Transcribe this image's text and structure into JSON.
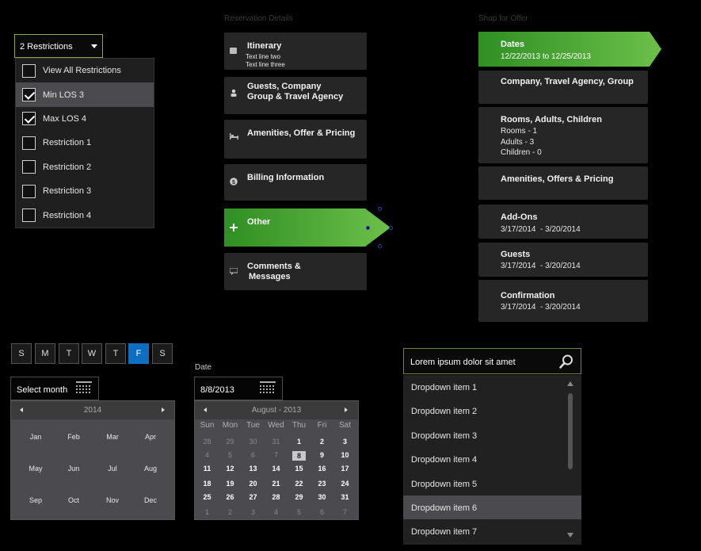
{
  "restrictions": {
    "button_label": "2 Restrictions",
    "items": [
      {
        "label": "View All Restrictions",
        "checked": false
      },
      {
        "label": "Min LOS 3",
        "checked": true
      },
      {
        "label": "Max LOS 4",
        "checked": true
      },
      {
        "label": "Restriction 1",
        "checked": false
      },
      {
        "label": "Restriction 2",
        "checked": false
      },
      {
        "label": "Restriction 3",
        "checked": false
      },
      {
        "label": "Restriction 4",
        "checked": false
      }
    ]
  },
  "reservation": {
    "title": "Reservation Details",
    "steps": [
      {
        "label": "Itinerary",
        "sub1": "Text line two",
        "sub2": "Text line three",
        "icon": "itinerary-icon"
      },
      {
        "label": "Guests, Company",
        "label2": "Group & Travel Agency",
        "icon": "person-icon"
      },
      {
        "label": "Amenities, Offer & Pricing",
        "icon": "bed-icon"
      },
      {
        "label": "Billing Information",
        "icon": "dollar-icon"
      },
      {
        "label": "Other",
        "icon": "plus-icon",
        "active": true
      },
      {
        "label": "Comments &",
        "label2": "Messages",
        "icon": "comment-icon"
      }
    ]
  },
  "shop": {
    "title": "Shop for Offer",
    "steps": [
      {
        "label": "Dates",
        "value": "12/22/2013  to 12/25/2013",
        "active": true
      },
      {
        "label": "Company, Travel Agency, Group"
      },
      {
        "label": "Rooms, Adults, Children",
        "value": "Rooms - 1\nAdults - 3\nChildren - 0"
      },
      {
        "label": "Amenities, Offers & Pricing"
      },
      {
        "label": "Add-Ons",
        "value": "3/17/2014  - 3/20/2014"
      },
      {
        "label": "Guests",
        "value": "3/17/2014  - 3/20/2014"
      },
      {
        "label": "Confirmation",
        "value": "3/17/2014  - 3/20/2014"
      }
    ]
  },
  "weekdays": {
    "items": [
      "S",
      "M",
      "T",
      "W",
      "T",
      "F",
      "S"
    ],
    "selected_index": 5
  },
  "month_picker": {
    "label": "Select month",
    "year": "2014",
    "months": [
      "Jan",
      "Feb",
      "Mar",
      "Apr",
      "May",
      "Jun",
      "Jul",
      "Aug",
      "Sep",
      "Oct",
      "Nov",
      "Dec"
    ]
  },
  "date_picker": {
    "label": "Date",
    "value": "8/8/2013",
    "header": "August - 2013",
    "dow": [
      "Sun",
      "Mon",
      "Tue",
      "Wed",
      "Thu",
      "Fri",
      "Sat"
    ],
    "weeks": [
      [
        "28",
        "29",
        "30",
        "31",
        "1",
        "2",
        "3"
      ],
      [
        "4",
        "5",
        "6",
        "7",
        "8",
        "9",
        "10"
      ],
      [
        "11",
        "12",
        "13",
        "14",
        "15",
        "16",
        "17"
      ],
      [
        "18",
        "19",
        "20",
        "21",
        "22",
        "23",
        "24"
      ],
      [
        "25",
        "26",
        "27",
        "28",
        "29",
        "30",
        "31"
      ],
      [
        "1",
        "2",
        "3",
        "4",
        "5",
        "6",
        "7"
      ]
    ],
    "selected": "8"
  },
  "search_dropdown": {
    "value": "Lorem ipsum dolor sit amet",
    "items": [
      "Dropdown item 1",
      "Dropdown item 2",
      "Dropdown item 3",
      "Dropdown item 4",
      "Dropdown item 5",
      "Dropdown item 6",
      "Dropdown item 7"
    ],
    "selected_index": 5
  },
  "colors": {
    "accent_green": "#3a9a2a",
    "selected_blue": "#0d6ec2"
  }
}
